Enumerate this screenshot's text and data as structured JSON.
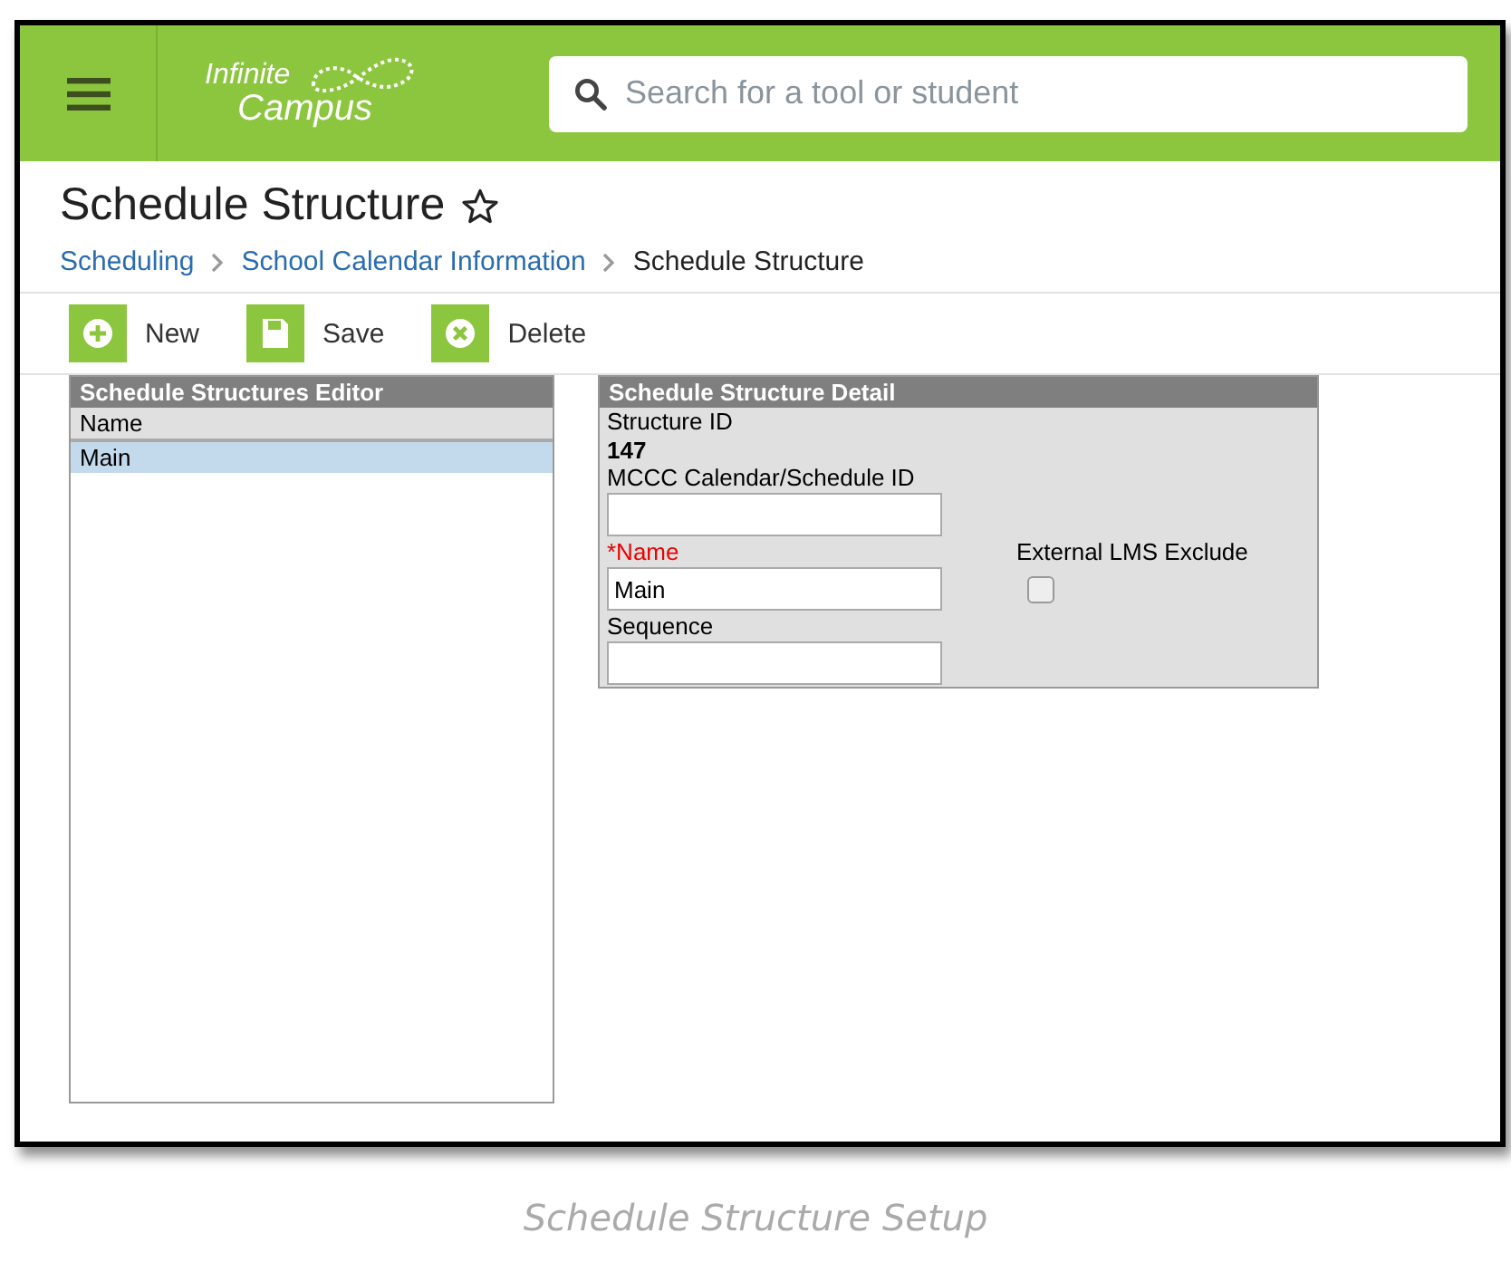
{
  "header": {
    "logo": [
      "Infinite",
      "Campus"
    ],
    "search": {
      "placeholder": "Search for a tool or student"
    }
  },
  "page": {
    "title": "Schedule Structure",
    "favorite": false,
    "breadcrumbs": [
      {
        "label": "Scheduling",
        "link": true
      },
      {
        "label": "School Calendar Information",
        "link": true
      },
      {
        "label": "Schedule Structure",
        "link": false
      }
    ]
  },
  "toolbar": [
    {
      "label": "New",
      "kind": "new"
    },
    {
      "label": "Save",
      "kind": "save"
    },
    {
      "label": "Delete",
      "kind": "delete"
    }
  ],
  "editor": {
    "title": "Schedule Structures Editor",
    "column": "Name",
    "rows": [
      {
        "name": "Main",
        "selected": true
      }
    ]
  },
  "detail": {
    "title": "Schedule Structure Detail",
    "id_label": "Structure ID",
    "id_value": "147",
    "mccc_label": "MCCC Calendar/Schedule ID",
    "name_label": "Name",
    "name_required_mark": "*",
    "name_value": "Main",
    "sequence_label": "Sequence",
    "lms_label": "External LMS Exclude",
    "lms_checked": false
  },
  "caption": "Schedule Structure Setup"
}
